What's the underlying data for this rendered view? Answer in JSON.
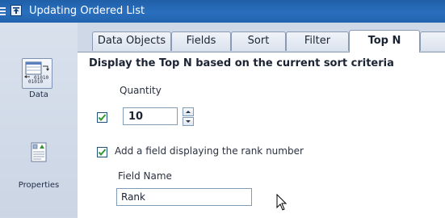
{
  "window": {
    "title": "Updating Ordered List"
  },
  "sidebar": {
    "items": [
      {
        "label": "Data"
      },
      {
        "label": "Properties"
      }
    ]
  },
  "tabs": [
    {
      "label": "Data Objects",
      "active": false
    },
    {
      "label": "Fields",
      "active": false
    },
    {
      "label": "Sort",
      "active": false
    },
    {
      "label": "Filter",
      "active": false
    },
    {
      "label": "Top N",
      "active": true
    }
  ],
  "topn": {
    "heading": "Display the Top N based on the current sort criteria",
    "quantity_label": "Quantity",
    "quantity_checked": true,
    "quantity_value": "10",
    "rank_checkbox_label": "Add a field displaying the rank number",
    "rank_checked": true,
    "field_name_label": "Field Name",
    "field_name_value": "Rank"
  },
  "colors": {
    "titlebar": "#2a6fbe",
    "check": "#2c9a2c",
    "tab_border": "#8b9ab4"
  },
  "icons": [
    "menu-lines-icon",
    "pin-icon",
    "data-icon",
    "properties-icon",
    "checkmark-icon",
    "arrow-up-icon",
    "arrow-down-icon",
    "mouse-cursor-icon"
  ]
}
